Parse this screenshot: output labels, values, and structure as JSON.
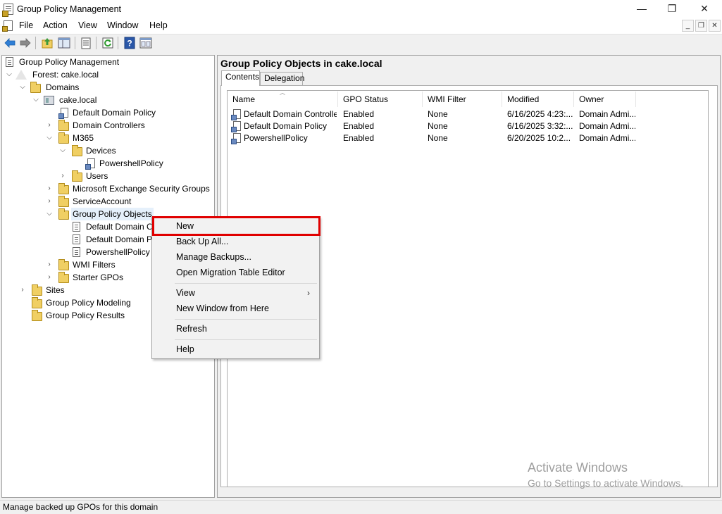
{
  "window": {
    "title": "Group Policy Management",
    "minimize_glyph": "—",
    "maximize_glyph": "❐",
    "close_glyph": "✕"
  },
  "menu": {
    "items": [
      "File",
      "Action",
      "View",
      "Window",
      "Help"
    ],
    "mdi_minimize": "_",
    "mdi_restore": "❐",
    "mdi_close": "✕"
  },
  "toolbar": {
    "icons": [
      "back-arrow-icon",
      "forward-arrow-icon",
      "up-folder-icon",
      "show-hide-tree-icon",
      "properties-icon",
      "refresh-icon",
      "help-icon",
      "console-icon"
    ]
  },
  "tree": {
    "root": "Group Policy Management",
    "forest": "Forest: cake.local",
    "domains": "Domains",
    "domain": "cake.local",
    "default_domain_policy": "Default Domain Policy",
    "domain_controllers": "Domain Controllers",
    "m365": "M365",
    "devices": "Devices",
    "powershell_policy": "PowershellPolicy",
    "users": "Users",
    "exchange_groups": "Microsoft Exchange Security Groups",
    "service_account": "ServiceAccount",
    "gpo_container": "Group Policy Objects",
    "gpo_children": [
      "Default Domain C",
      "Default Domain P",
      "PowershellPolicy"
    ],
    "wmi_filters": "WMI Filters",
    "starter_gpos": "Starter GPOs",
    "sites": "Sites",
    "modeling": "Group Policy Modeling",
    "results": "Group Policy Results"
  },
  "detail": {
    "title": "Group Policy Objects in cake.local",
    "tabs": [
      "Contents",
      "Delegation"
    ],
    "columns": [
      "Name",
      "GPO Status",
      "WMI Filter",
      "Modified",
      "Owner"
    ],
    "rows": [
      [
        "Default Domain Controller...",
        "Enabled",
        "None",
        "6/16/2025 4:23:...",
        "Domain Admi..."
      ],
      [
        "Default Domain Policy",
        "Enabled",
        "None",
        "6/16/2025 3:32:...",
        "Domain Admi..."
      ],
      [
        "PowershellPolicy",
        "Enabled",
        "None",
        "6/20/2025 10:2...",
        "Domain Admi..."
      ]
    ]
  },
  "context_menu": {
    "new": "New",
    "back_up_all": "Back Up All...",
    "manage_backups": "Manage Backups...",
    "open_migration": "Open Migration Table Editor",
    "view": "View",
    "new_window": "New Window from Here",
    "refresh": "Refresh",
    "help": "Help"
  },
  "watermark": {
    "line1": "Activate Windows",
    "line2": "Go to Settings to activate Windows."
  },
  "status": {
    "text": "Manage backed up GPOs for this domain"
  },
  "colors": {
    "highlight_border": "#e00000",
    "selection": "#e5f0fb"
  }
}
